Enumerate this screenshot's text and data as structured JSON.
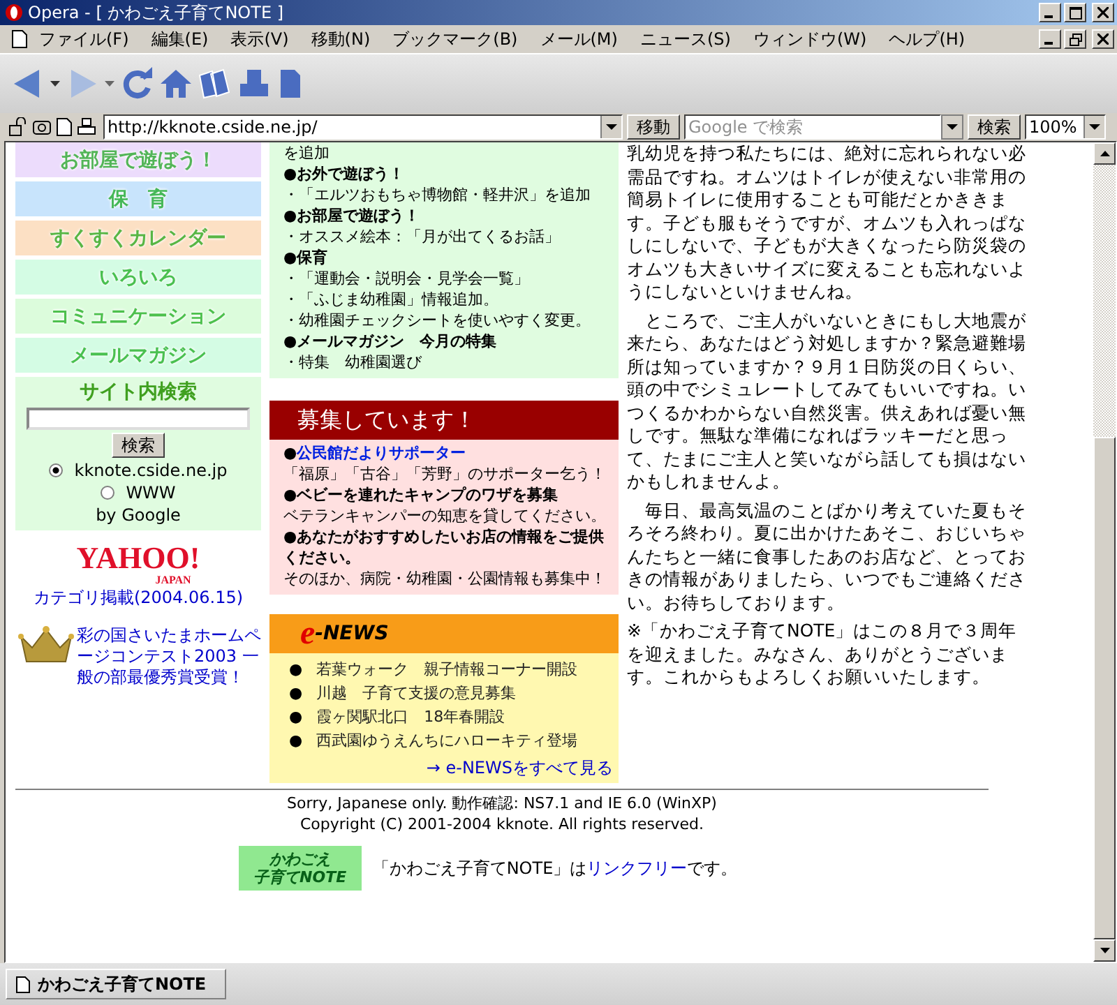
{
  "window": {
    "title": "Opera - [ かわごえ子育てNOTE ]"
  },
  "menu": [
    "ファイル(F)",
    "編集(E)",
    "表示(V)",
    "移動(N)",
    "ブックマーク(B)",
    "メール(M)",
    "ニュース(S)",
    "ウィンドウ(W)",
    "ヘルプ(H)"
  ],
  "address_bar": {
    "url": "http://kknote.cside.ne.jp/",
    "go_button": "移動",
    "search_placeholder": "Google で検索",
    "search_button": "検索",
    "zoom": "100%"
  },
  "nav": [
    {
      "label": "お部屋で遊ぼう！",
      "color": "#ecdcfc"
    },
    {
      "label": "保　育",
      "color": "#c8e4fc"
    },
    {
      "label": "すくすくカレンダー",
      "color": "#fce0c4"
    },
    {
      "label": "いろいろ",
      "color": "#d4fce4"
    },
    {
      "label": "コミュニケーション",
      "color": "#dcfcdc"
    },
    {
      "label": "メールマガジン",
      "color": "#d4fce4"
    }
  ],
  "site_search": {
    "title": "サイト内検索",
    "button": "検索",
    "options": [
      {
        "label": "kknote.cside.ne.jp",
        "selected": true
      },
      {
        "label": "WWW",
        "selected": false
      }
    ],
    "credit": "by Google"
  },
  "yahoo": {
    "logo": "YAHOO!",
    "sub": "JAPAN",
    "link": "カテゴリ掲載(2004.06.15)"
  },
  "award": "彩の国さいたまホームページコンテスト2003 一般の部最優秀賞受賞！",
  "updates": [
    {
      "kind": "line",
      "text": "を追加"
    },
    {
      "kind": "heading",
      "text": "●お外で遊ぼう！"
    },
    {
      "kind": "line",
      "text": "・「エルツおもちゃ博物館・軽井沢」を追加"
    },
    {
      "kind": "heading",
      "text": "●お部屋で遊ぼう！"
    },
    {
      "kind": "line",
      "text": "・オススメ絵本：「月が出てくるお話」"
    },
    {
      "kind": "heading",
      "text": "●保育"
    },
    {
      "kind": "line",
      "text": "・「運動会・説明会・見学会一覧」"
    },
    {
      "kind": "line",
      "text": "・「ふじま幼稚園」情報追加。"
    },
    {
      "kind": "line",
      "text": "・幼稚園チェックシートを使いやすく変更。"
    },
    {
      "kind": "heading",
      "text": "●メールマガジン　今月の特集"
    },
    {
      "kind": "line",
      "text": "・特集　幼稚園選び"
    }
  ],
  "recruiting": {
    "title": "募集しています！",
    "items": [
      {
        "kind": "link",
        "bullet": "●",
        "text": "公民館だよりサポーター"
      },
      {
        "kind": "line",
        "text": "「福原」「古谷」「芳野」のサポーター乞う！"
      },
      {
        "kind": "heading",
        "text": "●ベビーを連れたキャンプのワザを募集"
      },
      {
        "kind": "line",
        "text": "ベテランキャンパーの知恵を貸してください。"
      },
      {
        "kind": "heading",
        "text": "●あなたがおすすめしたいお店の情報をご提供ください。"
      },
      {
        "kind": "line",
        "text": "そのほか、病院・幼稚園・公園情報も募集中！"
      }
    ]
  },
  "enews": {
    "title_e": "e",
    "title": "-NEWS",
    "items": [
      {
        "bullet": "●",
        "text": "若葉ウォーク　親子情報コーナー開設"
      },
      {
        "bullet": "●",
        "text": "川越　子育て支援の意見募集"
      },
      {
        "bullet": "●",
        "text": "霞ヶ関駅北口　18年春開設"
      },
      {
        "bullet": "●",
        "text": "西武園ゆうえんちにハローキティ登場"
      }
    ],
    "more": "→ e-NEWSをすべて見る"
  },
  "article": [
    "乳幼児を持つ私たちには、絶対に忘れられない必需品ですね。オムツはトイレが使えない非常用の簡易トイレに使用することも可能だとかききます。子ども服もそうですが、オムツも入れっぱなしにしないで、子どもが大きくなったら防災袋のオムツも大きいサイズに変えることも忘れないようにしないといけませんね。",
    "　ところで、ご主人がいないときにもし大地震が来たら、あなたはどう対処しますか？緊急避難場所は知っていますか？９月１日防災の日くらい、頭の中でシミュレートしてみてもいいですね。いつくるかわからない自然災害。供えあれば憂い無しです。無駄な準備になればラッキーだと思って、たまにご主人と笑いながら話しても損はないかもしれませんよ。",
    "　毎日、最高気温のことばかり考えていた夏もそろそろ終わり。夏に出かけたあそこ、おじいちゃんたちと一緒に食事したあのお店など、とっておきの情報がありましたら、いつでもご連絡ください。お待ちしております。",
    "※「かわごえ子育てNOTE」はこの８月で３周年を迎えました。みなさん、ありがとうございます。これからもよろしくお願いいたします。"
  ],
  "footer": {
    "lines": [
      "Sorry, Japanese only. 動作確認: NS7.1 and IE 6.0 (WinXP)",
      "Copyright (C) 2001-2004 kknote. All rights reserved."
    ],
    "badge": [
      "かわごえ",
      "子育てNOTE"
    ],
    "link_before": "「かわごえ子育てNOTE」は",
    "link": "リンクフリー",
    "link_after": "です。"
  },
  "status_bar": {
    "tab": "かわごえ子育てNOTE"
  }
}
